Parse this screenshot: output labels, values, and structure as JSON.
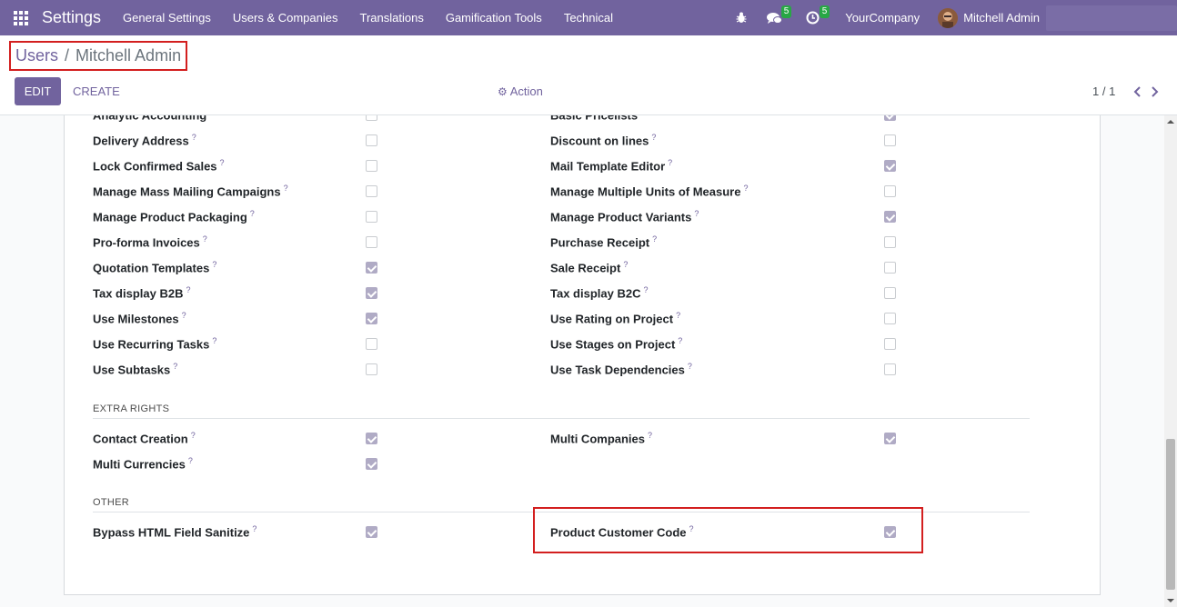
{
  "navbar": {
    "brand": "Settings",
    "menu": [
      "General Settings",
      "Users & Companies",
      "Translations",
      "Gamification Tools",
      "Technical"
    ],
    "messages_count": "5",
    "activities_count": "5",
    "company": "YourCompany",
    "user": "Mitchell Admin"
  },
  "breadcrumb": {
    "parent": "Users",
    "separator": "/",
    "current": "Mitchell Admin"
  },
  "toolbar": {
    "edit_label": "EDIT",
    "create_label": "CREATE",
    "action_label": "Action"
  },
  "pager": {
    "value": "1 / 1"
  },
  "technical_rows": [
    {
      "left": {
        "label": "Analytic Accounting",
        "checked": false
      },
      "right": {
        "label": "Basic Pricelists",
        "checked": true
      }
    },
    {
      "left": {
        "label": "Delivery Address",
        "checked": false
      },
      "right": {
        "label": "Discount on lines",
        "checked": false
      }
    },
    {
      "left": {
        "label": "Lock Confirmed Sales",
        "checked": false
      },
      "right": {
        "label": "Mail Template Editor",
        "checked": true
      }
    },
    {
      "left": {
        "label": "Manage Mass Mailing Campaigns",
        "checked": false
      },
      "right": {
        "label": "Manage Multiple Units of Measure",
        "checked": false
      }
    },
    {
      "left": {
        "label": "Manage Product Packaging",
        "checked": false
      },
      "right": {
        "label": "Manage Product Variants",
        "checked": true
      }
    },
    {
      "left": {
        "label": "Pro-forma Invoices",
        "checked": false
      },
      "right": {
        "label": "Purchase Receipt",
        "checked": false
      }
    },
    {
      "left": {
        "label": "Quotation Templates",
        "checked": true
      },
      "right": {
        "label": "Sale Receipt",
        "checked": false
      }
    },
    {
      "left": {
        "label": "Tax display B2B",
        "checked": true
      },
      "right": {
        "label": "Tax display B2C",
        "checked": false
      }
    },
    {
      "left": {
        "label": "Use Milestones",
        "checked": true
      },
      "right": {
        "label": "Use Rating on Project",
        "checked": false
      }
    },
    {
      "left": {
        "label": "Use Recurring Tasks",
        "checked": false
      },
      "right": {
        "label": "Use Stages on Project",
        "checked": false
      }
    },
    {
      "left": {
        "label": "Use Subtasks",
        "checked": false
      },
      "right": {
        "label": "Use Task Dependencies",
        "checked": false
      }
    }
  ],
  "extra_rights": {
    "title": "EXTRA RIGHTS",
    "rows": [
      {
        "left": {
          "label": "Contact Creation",
          "checked": true
        },
        "right": {
          "label": "Multi Companies",
          "checked": true
        }
      },
      {
        "left": {
          "label": "Multi Currencies",
          "checked": true
        }
      }
    ]
  },
  "other": {
    "title": "OTHER",
    "rows": [
      {
        "left": {
          "label": "Bypass HTML Field Sanitize",
          "checked": true
        },
        "right": {
          "label": "Product Customer Code",
          "checked": true
        }
      }
    ]
  },
  "help_mark": "?",
  "colors": {
    "navbar": "#71639e",
    "highlight": "#d31f1f",
    "checked": "#b0abc5"
  }
}
